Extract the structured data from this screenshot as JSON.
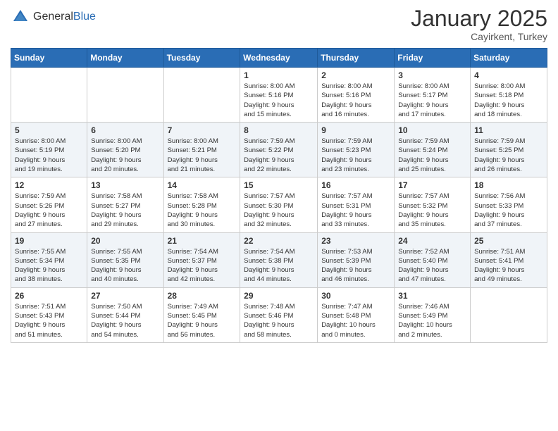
{
  "header": {
    "logo_general": "General",
    "logo_blue": "Blue",
    "month_title": "January 2025",
    "location": "Cayirkent, Turkey"
  },
  "days_of_week": [
    "Sunday",
    "Monday",
    "Tuesday",
    "Wednesday",
    "Thursday",
    "Friday",
    "Saturday"
  ],
  "weeks": [
    [
      {
        "day": "",
        "info": ""
      },
      {
        "day": "",
        "info": ""
      },
      {
        "day": "",
        "info": ""
      },
      {
        "day": "1",
        "info": "Sunrise: 8:00 AM\nSunset: 5:16 PM\nDaylight: 9 hours\nand 15 minutes."
      },
      {
        "day": "2",
        "info": "Sunrise: 8:00 AM\nSunset: 5:16 PM\nDaylight: 9 hours\nand 16 minutes."
      },
      {
        "day": "3",
        "info": "Sunrise: 8:00 AM\nSunset: 5:17 PM\nDaylight: 9 hours\nand 17 minutes."
      },
      {
        "day": "4",
        "info": "Sunrise: 8:00 AM\nSunset: 5:18 PM\nDaylight: 9 hours\nand 18 minutes."
      }
    ],
    [
      {
        "day": "5",
        "info": "Sunrise: 8:00 AM\nSunset: 5:19 PM\nDaylight: 9 hours\nand 19 minutes."
      },
      {
        "day": "6",
        "info": "Sunrise: 8:00 AM\nSunset: 5:20 PM\nDaylight: 9 hours\nand 20 minutes."
      },
      {
        "day": "7",
        "info": "Sunrise: 8:00 AM\nSunset: 5:21 PM\nDaylight: 9 hours\nand 21 minutes."
      },
      {
        "day": "8",
        "info": "Sunrise: 7:59 AM\nSunset: 5:22 PM\nDaylight: 9 hours\nand 22 minutes."
      },
      {
        "day": "9",
        "info": "Sunrise: 7:59 AM\nSunset: 5:23 PM\nDaylight: 9 hours\nand 23 minutes."
      },
      {
        "day": "10",
        "info": "Sunrise: 7:59 AM\nSunset: 5:24 PM\nDaylight: 9 hours\nand 25 minutes."
      },
      {
        "day": "11",
        "info": "Sunrise: 7:59 AM\nSunset: 5:25 PM\nDaylight: 9 hours\nand 26 minutes."
      }
    ],
    [
      {
        "day": "12",
        "info": "Sunrise: 7:59 AM\nSunset: 5:26 PM\nDaylight: 9 hours\nand 27 minutes."
      },
      {
        "day": "13",
        "info": "Sunrise: 7:58 AM\nSunset: 5:27 PM\nDaylight: 9 hours\nand 29 minutes."
      },
      {
        "day": "14",
        "info": "Sunrise: 7:58 AM\nSunset: 5:28 PM\nDaylight: 9 hours\nand 30 minutes."
      },
      {
        "day": "15",
        "info": "Sunrise: 7:57 AM\nSunset: 5:30 PM\nDaylight: 9 hours\nand 32 minutes."
      },
      {
        "day": "16",
        "info": "Sunrise: 7:57 AM\nSunset: 5:31 PM\nDaylight: 9 hours\nand 33 minutes."
      },
      {
        "day": "17",
        "info": "Sunrise: 7:57 AM\nSunset: 5:32 PM\nDaylight: 9 hours\nand 35 minutes."
      },
      {
        "day": "18",
        "info": "Sunrise: 7:56 AM\nSunset: 5:33 PM\nDaylight: 9 hours\nand 37 minutes."
      }
    ],
    [
      {
        "day": "19",
        "info": "Sunrise: 7:55 AM\nSunset: 5:34 PM\nDaylight: 9 hours\nand 38 minutes."
      },
      {
        "day": "20",
        "info": "Sunrise: 7:55 AM\nSunset: 5:35 PM\nDaylight: 9 hours\nand 40 minutes."
      },
      {
        "day": "21",
        "info": "Sunrise: 7:54 AM\nSunset: 5:37 PM\nDaylight: 9 hours\nand 42 minutes."
      },
      {
        "day": "22",
        "info": "Sunrise: 7:54 AM\nSunset: 5:38 PM\nDaylight: 9 hours\nand 44 minutes."
      },
      {
        "day": "23",
        "info": "Sunrise: 7:53 AM\nSunset: 5:39 PM\nDaylight: 9 hours\nand 46 minutes."
      },
      {
        "day": "24",
        "info": "Sunrise: 7:52 AM\nSunset: 5:40 PM\nDaylight: 9 hours\nand 47 minutes."
      },
      {
        "day": "25",
        "info": "Sunrise: 7:51 AM\nSunset: 5:41 PM\nDaylight: 9 hours\nand 49 minutes."
      }
    ],
    [
      {
        "day": "26",
        "info": "Sunrise: 7:51 AM\nSunset: 5:43 PM\nDaylight: 9 hours\nand 51 minutes."
      },
      {
        "day": "27",
        "info": "Sunrise: 7:50 AM\nSunset: 5:44 PM\nDaylight: 9 hours\nand 54 minutes."
      },
      {
        "day": "28",
        "info": "Sunrise: 7:49 AM\nSunset: 5:45 PM\nDaylight: 9 hours\nand 56 minutes."
      },
      {
        "day": "29",
        "info": "Sunrise: 7:48 AM\nSunset: 5:46 PM\nDaylight: 9 hours\nand 58 minutes."
      },
      {
        "day": "30",
        "info": "Sunrise: 7:47 AM\nSunset: 5:48 PM\nDaylight: 10 hours\nand 0 minutes."
      },
      {
        "day": "31",
        "info": "Sunrise: 7:46 AM\nSunset: 5:49 PM\nDaylight: 10 hours\nand 2 minutes."
      },
      {
        "day": "",
        "info": ""
      }
    ]
  ]
}
